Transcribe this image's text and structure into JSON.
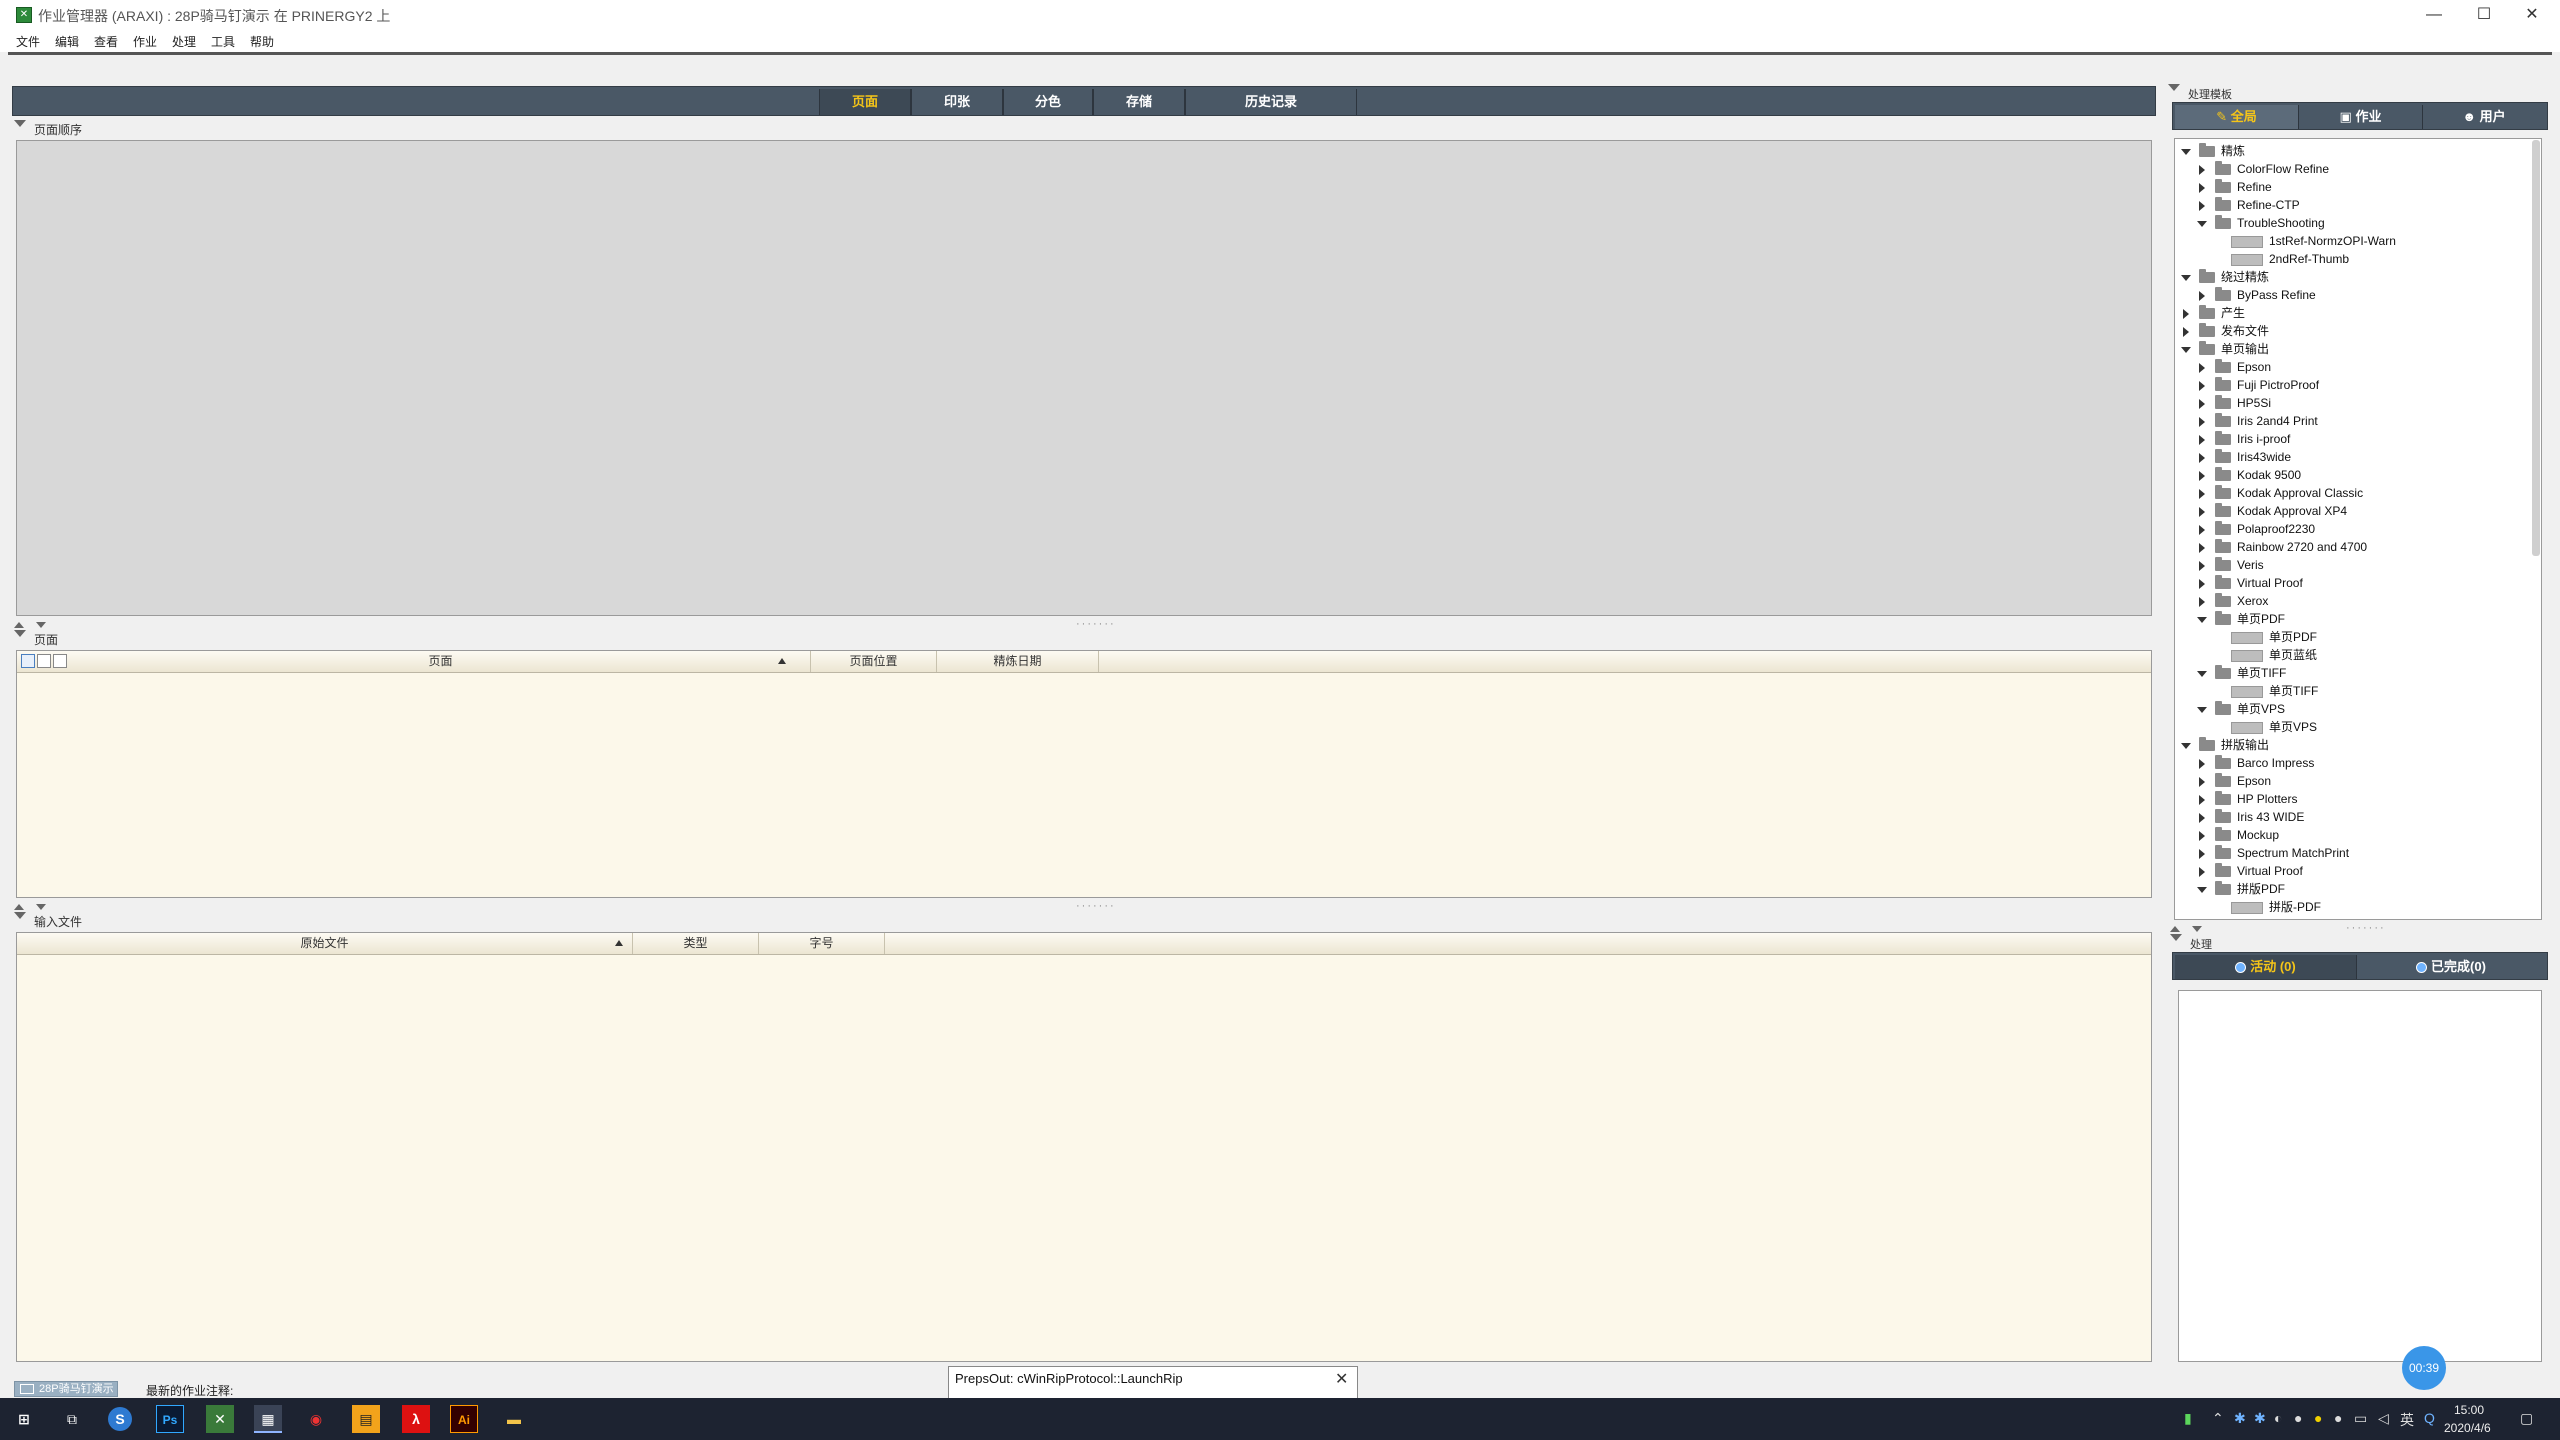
{
  "window": {
    "title": "作业管理器 (ARAXI) : 28P骑马钉演示 在 PRINERGY2 上",
    "minimize": "—",
    "maximize": "☐",
    "close": "✕"
  },
  "menu": [
    "文件",
    "编辑",
    "查看",
    "作业",
    "处理",
    "工具",
    "帮助"
  ],
  "main_tabs": [
    "页面",
    "印张",
    "分色",
    "存储",
    "历史记录"
  ],
  "active_main_tab": "页面",
  "sections": {
    "page_order": "页面顺序",
    "pages": "页面",
    "input_files": "输入文件"
  },
  "pages_table": {
    "columns": [
      "页面",
      "页面位置",
      "精炼日期"
    ]
  },
  "input_table": {
    "columns": [
      "原始文件",
      "类型",
      "字号"
    ]
  },
  "status": {
    "job_tab": "28P骑马钉演示",
    "recent_note": "最新的作业注释:"
  },
  "right_panel": {
    "title": "处理模板",
    "tabs": [
      "全局",
      "作业",
      "用户"
    ],
    "active_tab": "全局",
    "tree": [
      {
        "level": 0,
        "state": "open",
        "kind": "folder",
        "label": "精炼"
      },
      {
        "level": 1,
        "state": "closed",
        "kind": "folder",
        "label": "ColorFlow Refine"
      },
      {
        "level": 1,
        "state": "closed",
        "kind": "folder",
        "label": "Refine"
      },
      {
        "level": 1,
        "state": "closed",
        "kind": "folder",
        "label": "Refine-CTP"
      },
      {
        "level": 1,
        "state": "open",
        "kind": "folder",
        "label": "TroubleShooting"
      },
      {
        "level": 2,
        "state": "none",
        "kind": "template",
        "label": "1stRef-NormzOPI-Warn"
      },
      {
        "level": 2,
        "state": "none",
        "kind": "template",
        "label": "2ndRef-Thumb"
      },
      {
        "level": 0,
        "state": "open",
        "kind": "folder",
        "label": "绕过精炼"
      },
      {
        "level": 1,
        "state": "closed",
        "kind": "folder",
        "label": "ByPass Refine"
      },
      {
        "level": 0,
        "state": "closed",
        "kind": "folder",
        "label": "产生"
      },
      {
        "level": 0,
        "state": "closed",
        "kind": "folder",
        "label": "发布文件"
      },
      {
        "level": 0,
        "state": "open",
        "kind": "folder",
        "label": "单页输出"
      },
      {
        "level": 1,
        "state": "closed",
        "kind": "folder",
        "label": "Epson"
      },
      {
        "level": 1,
        "state": "closed",
        "kind": "folder",
        "label": "Fuji PictroProof"
      },
      {
        "level": 1,
        "state": "closed",
        "kind": "folder",
        "label": "HP5Si"
      },
      {
        "level": 1,
        "state": "closed",
        "kind": "folder",
        "label": "Iris 2and4 Print"
      },
      {
        "level": 1,
        "state": "closed",
        "kind": "folder",
        "label": "Iris i-proof"
      },
      {
        "level": 1,
        "state": "closed",
        "kind": "folder",
        "label": "Iris43wide"
      },
      {
        "level": 1,
        "state": "closed",
        "kind": "folder",
        "label": "Kodak 9500"
      },
      {
        "level": 1,
        "state": "closed",
        "kind": "folder",
        "label": "Kodak Approval Classic"
      },
      {
        "level": 1,
        "state": "closed",
        "kind": "folder",
        "label": "Kodak Approval XP4"
      },
      {
        "level": 1,
        "state": "closed",
        "kind": "folder",
        "label": "Polaproof2230"
      },
      {
        "level": 1,
        "state": "closed",
        "kind": "folder",
        "label": "Rainbow 2720 and 4700"
      },
      {
        "level": 1,
        "state": "closed",
        "kind": "folder",
        "label": "Veris"
      },
      {
        "level": 1,
        "state": "closed",
        "kind": "folder",
        "label": "Virtual Proof"
      },
      {
        "level": 1,
        "state": "closed",
        "kind": "folder",
        "label": "Xerox"
      },
      {
        "level": 1,
        "state": "open",
        "kind": "folder",
        "label": "单页PDF"
      },
      {
        "level": 2,
        "state": "none",
        "kind": "template",
        "label": "单页PDF"
      },
      {
        "level": 2,
        "state": "none",
        "kind": "template",
        "label": "单页蓝纸"
      },
      {
        "level": 1,
        "state": "open",
        "kind": "folder",
        "label": "单页TIFF"
      },
      {
        "level": 2,
        "state": "none",
        "kind": "template",
        "label": "单页TIFF"
      },
      {
        "level": 1,
        "state": "open",
        "kind": "folder",
        "label": "单页VPS"
      },
      {
        "level": 2,
        "state": "none",
        "kind": "template",
        "label": "单页VPS"
      },
      {
        "level": 0,
        "state": "open",
        "kind": "folder",
        "label": "拼版输出"
      },
      {
        "level": 1,
        "state": "closed",
        "kind": "folder",
        "label": "Barco Impress"
      },
      {
        "level": 1,
        "state": "closed",
        "kind": "folder",
        "label": "Epson"
      },
      {
        "level": 1,
        "state": "closed",
        "kind": "folder",
        "label": "HP Plotters"
      },
      {
        "level": 1,
        "state": "closed",
        "kind": "folder",
        "label": "Iris 43 WIDE"
      },
      {
        "level": 1,
        "state": "closed",
        "kind": "folder",
        "label": "Mockup"
      },
      {
        "level": 1,
        "state": "closed",
        "kind": "folder",
        "label": "Spectrum MatchPrint"
      },
      {
        "level": 1,
        "state": "closed",
        "kind": "folder",
        "label": "Virtual Proof"
      },
      {
        "level": 1,
        "state": "open",
        "kind": "folder",
        "label": "拼版PDF"
      },
      {
        "level": 2,
        "state": "none",
        "kind": "template",
        "label": "拼版-PDF"
      }
    ]
  },
  "process_panel": {
    "title": "处理",
    "tabs": [
      "活动 (0)",
      "已完成(0)"
    ],
    "active_tab": "活动 (0)"
  },
  "timer": "00:39",
  "popup": {
    "text": "PrepsOut: cWinRipProtocol::LaunchRip",
    "close": "✕"
  },
  "taskbar": {
    "time": "15:00",
    "date": "2020/4/6",
    "ime": "英",
    "apps": [
      "Ps",
      "Ai"
    ]
  },
  "colors": {
    "tab_bar": "#4a5866",
    "active_tab_text": "#f5c518",
    "table_bg": "#fcf8ea",
    "taskbar": "#1d2331",
    "timer": "#3a96e8"
  }
}
